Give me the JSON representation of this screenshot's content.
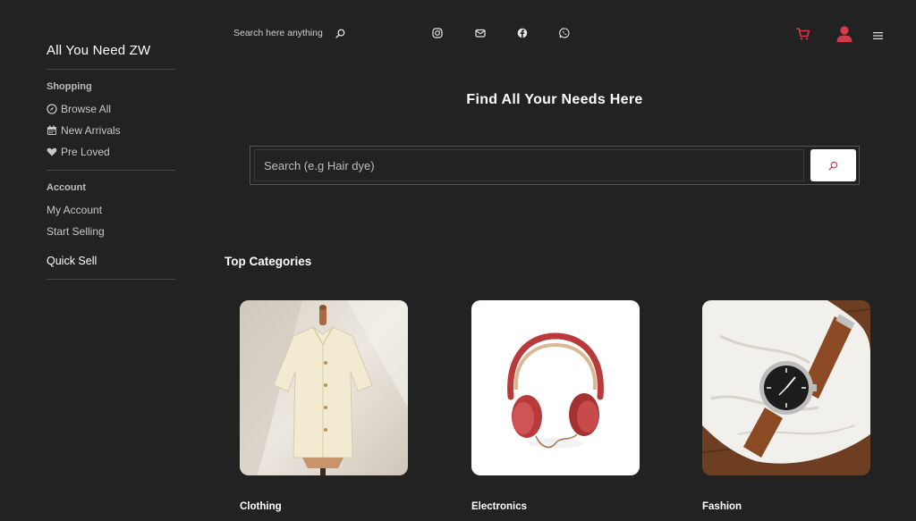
{
  "brand": "All You Need ZW",
  "sidebar": {
    "shopping_label": "Shopping",
    "shopping_items": [
      {
        "label": "Browse All",
        "icon": "compass-icon"
      },
      {
        "label": "New Arrivals",
        "icon": "calendar-icon"
      },
      {
        "label": "Pre Loved",
        "icon": "heart-icon"
      }
    ],
    "account_label": "Account",
    "account_items": [
      {
        "label": "My Account"
      },
      {
        "label": "Start Selling"
      }
    ],
    "quick_sell": "Quick Sell"
  },
  "header": {
    "search_placeholder": "Search here anything",
    "social_icons": [
      "instagram-icon",
      "mail-icon",
      "facebook-icon",
      "whatsapp-icon"
    ],
    "cart_icon": "cart-icon",
    "user_icon": "user-icon",
    "menu_icon": "hamburger-menu-icon"
  },
  "hero": {
    "title": "Find All Your Needs Here",
    "search_placeholder": "Search (e.g Hair dye)"
  },
  "categories": {
    "heading": "Top Categories",
    "items": [
      {
        "label": "Clothing"
      },
      {
        "label": "Electronics"
      },
      {
        "label": "Fashion"
      }
    ]
  },
  "colors": {
    "background": "#222222",
    "accent": "#d63a4a",
    "text": "#ffffff"
  }
}
